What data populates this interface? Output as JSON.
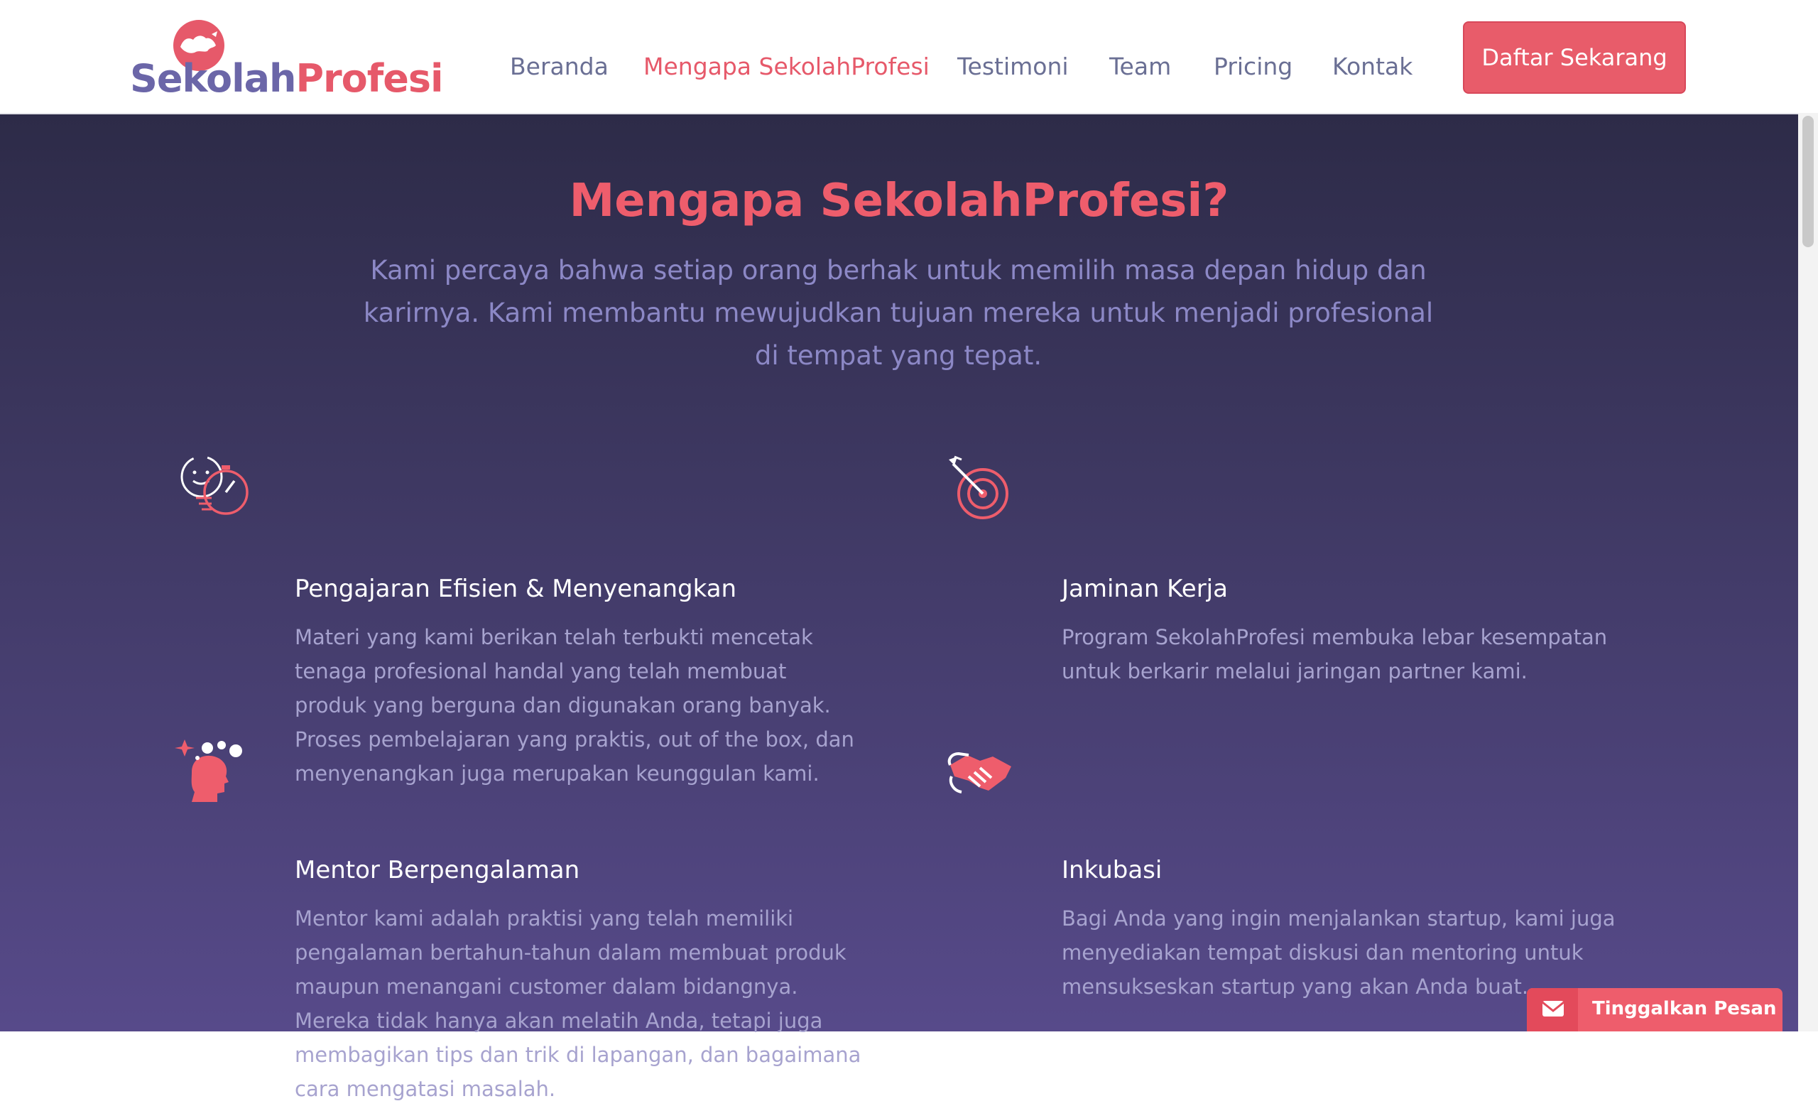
{
  "header": {
    "logo": {
      "part1": "Sekolah",
      "part2": "Profesi"
    },
    "nav": [
      {
        "label": "Beranda"
      },
      {
        "label": "Mengapa SekolahProfesi",
        "active": true
      },
      {
        "label": "Testimoni"
      },
      {
        "label": "Team"
      },
      {
        "label": "Pricing"
      },
      {
        "label": "Kontak"
      }
    ],
    "cta_label": "Daftar Sekarang"
  },
  "section": {
    "title": "Mengapa SekolahProfesi?",
    "subtitle": "Kami percaya bahwa setiap orang berhak untuk memilih masa depan hidup dan karirnya. Kami membantu mewujudkan tujuan mereka untuk menjadi profesional di tempat yang tepat.",
    "features": [
      {
        "icon": "stopwatch-face-icon",
        "title": "Pengajaran Efisien & Menyenangkan",
        "text": "Materi yang kami berikan telah terbukti mencetak tenaga profesional handal yang telah membuat produk yang berguna dan digunakan orang banyak. Proses pembelajaran yang praktis, out of the box, dan menyenangkan juga merupakan keunggulan kami."
      },
      {
        "icon": "target-dart-icon",
        "title": "Jaminan Kerja",
        "text": "Program SekolahProfesi membuka lebar kesempatan untuk berkarir melalui jaringan partner kami."
      },
      {
        "icon": "head-ideas-icon",
        "title": "Mentor Berpengalaman",
        "text": "Mentor kami adalah praktisi yang telah memiliki pengalaman bertahun-tahun dalam membuat produk maupun menangani customer dalam bidangnya. Mereka tidak hanya akan melatih Anda, tetapi juga membagikan tips dan trik di lapangan, dan bagaimana cara mengatasi masalah."
      },
      {
        "icon": "handshake-icon",
        "title": "Inkubasi",
        "text": "Bagi Anda yang ingin menjalankan startup, kami juga menyediakan tempat diskusi dan mentoring untuk mensukseskan startup yang akan Anda buat."
      }
    ]
  },
  "widget": {
    "icon": "envelope-icon",
    "label": "Tinggalkan Pesan"
  },
  "colors": {
    "accent": "#e6596a",
    "brand_purple": "#6b66a8",
    "nav_text": "#6a6f94",
    "section_top": "#2d2b48",
    "section_bottom": "#574a8a"
  }
}
